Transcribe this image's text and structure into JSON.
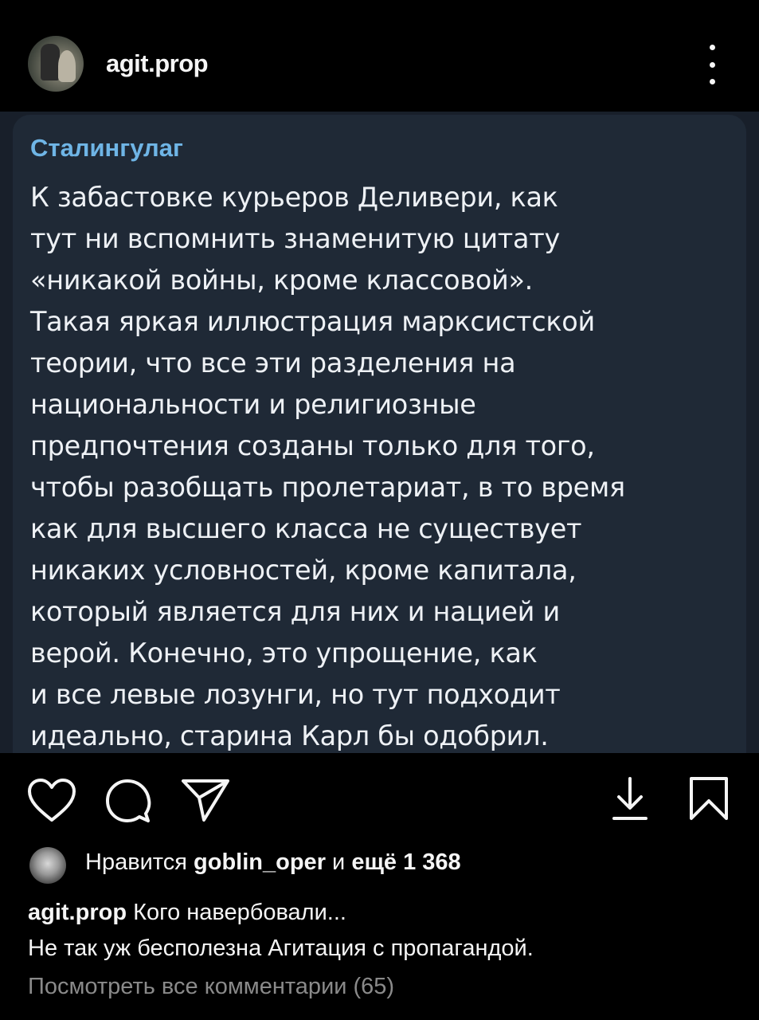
{
  "header": {
    "username": "agit.prop",
    "avatar_icon": "profile-photo"
  },
  "message": {
    "sender": "Сталингулаг",
    "lines": [
      "К забастовке курьеров Деливери, как",
      "тут ни вспомнить знаменитую цитату",
      "«никакой войны, кроме классовой».",
      "Такая яркая иллюстрация марксистской",
      "теории, что все эти разделения на",
      "национальности и религиозные",
      "предпочтения созданы только для того,",
      "чтобы разобщать пролетариат, в то время",
      "как для высшего класса не существует",
      "никаких условностей, кроме капитала,",
      "который является для них и нацией и",
      "верой. Конечно, это упрощение, как",
      "и все левые лозунги, но тут подходит",
      "идеально, старина Карл бы одобрил."
    ]
  },
  "actions": {
    "icons": [
      "heart-icon",
      "comment-icon",
      "send-icon",
      "download-icon",
      "bookmark-icon"
    ]
  },
  "likes": {
    "prefix": "Нравится",
    "user": "goblin_oper",
    "middle": "и",
    "count": "ещё 1 368"
  },
  "caption": {
    "author": "agit.prop",
    "line1": "Кого навербовали...",
    "line2": "Не так уж бесполезна Агитация с пропагандой."
  },
  "comments": {
    "view_all": "Посмотреть все комментарии (65)"
  },
  "colors": {
    "background": "#000000",
    "card": "#1f2936",
    "sender": "#6fb5e6",
    "muted": "#8a8a8a"
  }
}
